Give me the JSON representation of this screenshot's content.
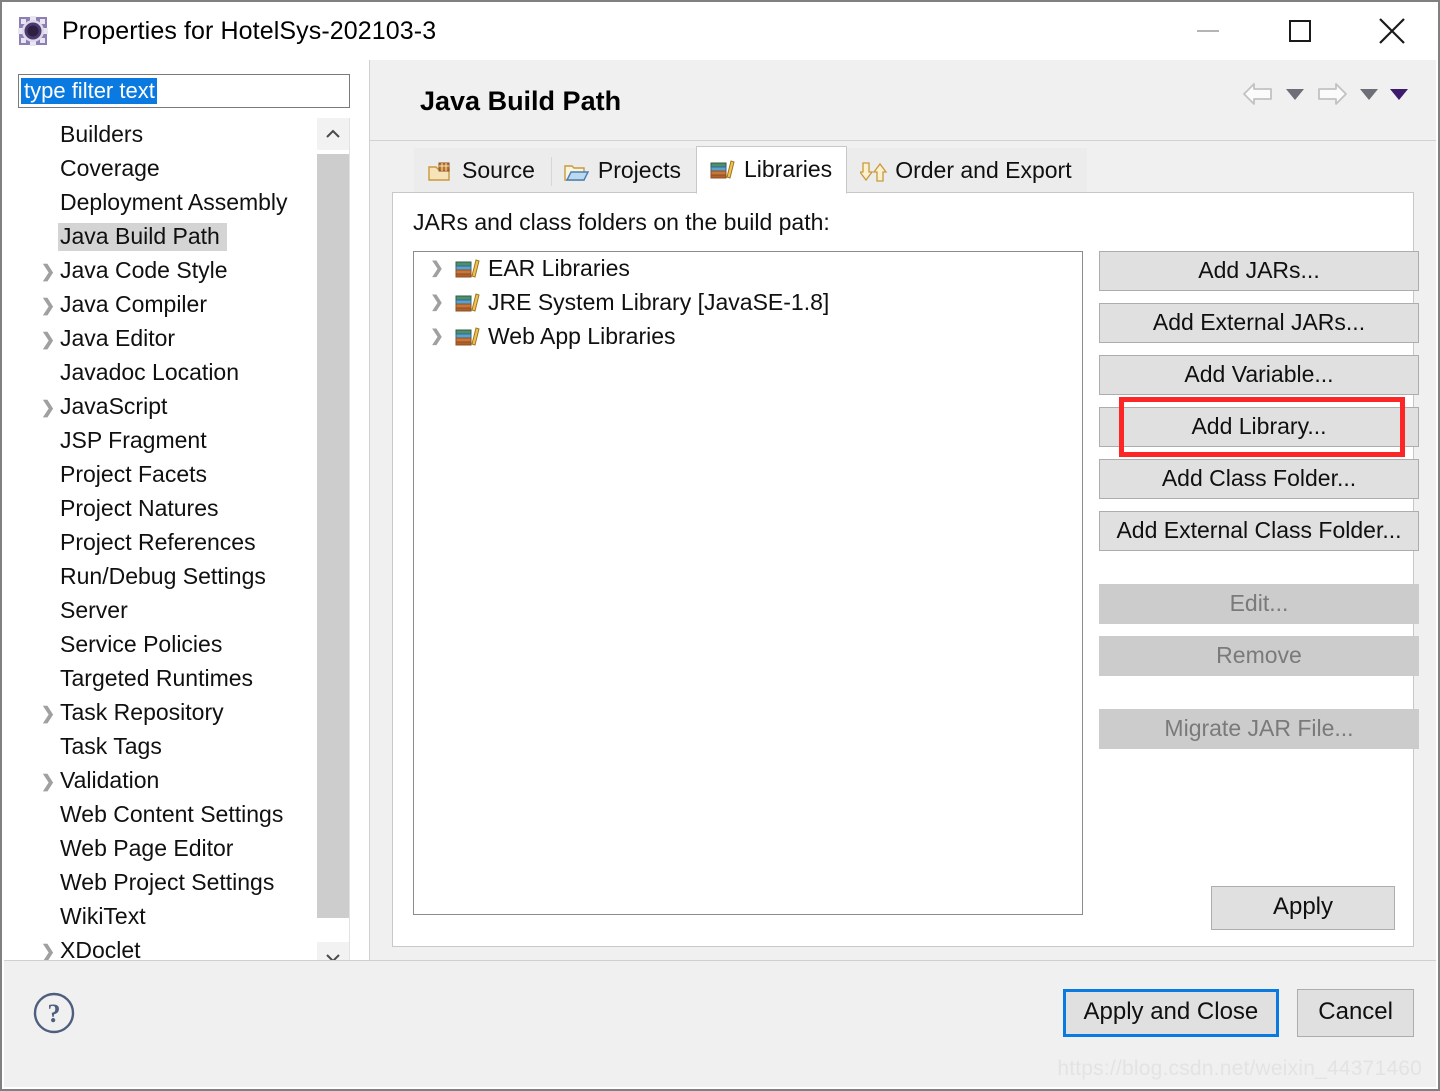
{
  "window": {
    "title": "Properties for HotelSys-202103-3",
    "icon": "eclipse-properties-icon",
    "controls": {
      "minimize": "minimize-icon",
      "maximize": "maximize-icon",
      "close": "close-icon"
    }
  },
  "sidebar": {
    "filter": {
      "value": "type filter text",
      "placeholder": "type filter text"
    },
    "items": [
      {
        "label": "Builders",
        "expandable": false,
        "selected": false
      },
      {
        "label": "Coverage",
        "expandable": false,
        "selected": false
      },
      {
        "label": "Deployment Assembly",
        "expandable": false,
        "selected": false
      },
      {
        "label": "Java Build Path",
        "expandable": false,
        "selected": true
      },
      {
        "label": "Java Code Style",
        "expandable": true,
        "selected": false
      },
      {
        "label": "Java Compiler",
        "expandable": true,
        "selected": false
      },
      {
        "label": "Java Editor",
        "expandable": true,
        "selected": false
      },
      {
        "label": "Javadoc Location",
        "expandable": false,
        "selected": false
      },
      {
        "label": "JavaScript",
        "expandable": true,
        "selected": false
      },
      {
        "label": "JSP Fragment",
        "expandable": false,
        "selected": false
      },
      {
        "label": "Project Facets",
        "expandable": false,
        "selected": false
      },
      {
        "label": "Project Natures",
        "expandable": false,
        "selected": false
      },
      {
        "label": "Project References",
        "expandable": false,
        "selected": false
      },
      {
        "label": "Run/Debug Settings",
        "expandable": false,
        "selected": false
      },
      {
        "label": "Server",
        "expandable": false,
        "selected": false
      },
      {
        "label": "Service Policies",
        "expandable": false,
        "selected": false
      },
      {
        "label": "Targeted Runtimes",
        "expandable": false,
        "selected": false
      },
      {
        "label": "Task Repository",
        "expandable": true,
        "selected": false
      },
      {
        "label": "Task Tags",
        "expandable": false,
        "selected": false
      },
      {
        "label": "Validation",
        "expandable": true,
        "selected": false
      },
      {
        "label": "Web Content Settings",
        "expandable": false,
        "selected": false
      },
      {
        "label": "Web Page Editor",
        "expandable": false,
        "selected": false
      },
      {
        "label": "Web Project Settings",
        "expandable": false,
        "selected": false
      },
      {
        "label": "WikiText",
        "expandable": false,
        "selected": false
      },
      {
        "label": "XDoclet",
        "expandable": true,
        "selected": false
      }
    ]
  },
  "main": {
    "page_title": "Java Build Path",
    "nav": {
      "back": "back-arrow-icon",
      "back_menu": "chevron-down-icon",
      "forward": "forward-arrow-icon",
      "forward_menu": "chevron-down-icon",
      "view_menu": "view-menu-icon"
    },
    "tabs": [
      {
        "label": "Source",
        "icon": "source-folder-icon",
        "active": false
      },
      {
        "label": "Projects",
        "icon": "projects-folder-icon",
        "active": false
      },
      {
        "label": "Libraries",
        "icon": "libraries-books-icon",
        "active": true
      },
      {
        "label": "Order and Export",
        "icon": "order-export-arrows-icon",
        "active": false
      }
    ],
    "list_caption": "JARs and class folders on the build path:",
    "libraries": [
      {
        "label": "EAR Libraries",
        "icon": "library-books-icon"
      },
      {
        "label": "JRE System Library [JavaSE-1.8]",
        "icon": "library-books-icon"
      },
      {
        "label": "Web App Libraries",
        "icon": "library-books-icon"
      }
    ],
    "side_buttons": [
      {
        "label": "Add JARs...",
        "enabled": true,
        "highlighted": false
      },
      {
        "label": "Add External JARs...",
        "enabled": true,
        "highlighted": false
      },
      {
        "label": "Add Variable...",
        "enabled": true,
        "highlighted": false
      },
      {
        "label": "Add Library...",
        "enabled": true,
        "highlighted": true
      },
      {
        "label": "Add Class Folder...",
        "enabled": true,
        "highlighted": false
      },
      {
        "label": "Add External Class Folder...",
        "enabled": true,
        "highlighted": false
      },
      {
        "label": "Edit...",
        "enabled": false,
        "highlighted": false
      },
      {
        "label": "Remove",
        "enabled": false,
        "highlighted": false
      },
      {
        "label": "Migrate JAR File...",
        "enabled": false,
        "highlighted": false
      }
    ],
    "apply_label": "Apply"
  },
  "footer": {
    "help": "help-question-icon",
    "apply_and_close": "Apply and Close",
    "cancel": "Cancel",
    "watermark": "https://blog.csdn.net/weixin_44371460"
  },
  "colors": {
    "highlight_red": "#fc2626",
    "selection_blue": "#0a7ae0",
    "tree_selected_bg": "#d4d4d4",
    "button_face": "#e0e0e0",
    "disabled_face": "#cccccc"
  }
}
